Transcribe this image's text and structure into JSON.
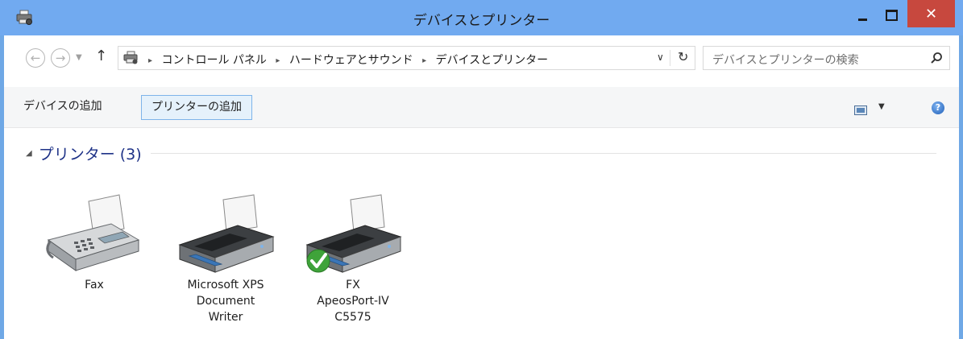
{
  "window": {
    "title": "デバイスとプリンター",
    "close_glyph": "✕"
  },
  "nav": {
    "back_glyph": "←",
    "forward_glyph": "→",
    "recent_glyph": "▼",
    "up_glyph": "↑",
    "breadcrumbs": [
      "コントロール パネル",
      "ハードウェアとサウンド",
      "デバイスとプリンター"
    ],
    "crumb_separator": "▸",
    "dropdown_glyph": "∨",
    "refresh_glyph": "↻",
    "search_placeholder": "デバイスとプリンターの検索"
  },
  "commands": {
    "add_device": "デバイスの追加",
    "add_printer": "プリンターの追加",
    "view_dropdown_glyph": "▼",
    "help_glyph": "?"
  },
  "group": {
    "collapse_glyph": "◢",
    "title": "プリンター (3)"
  },
  "devices": [
    {
      "label_lines": [
        "Fax"
      ],
      "icon": "fax-icon",
      "is_default": false
    },
    {
      "label_lines": [
        "Microsoft XPS",
        "Document",
        "Writer"
      ],
      "icon": "printer-icon",
      "is_default": false
    },
    {
      "label_lines": [
        "FX",
        "ApeosPort-IV",
        "C5575"
      ],
      "icon": "printer-icon",
      "is_default": true
    }
  ],
  "colors": {
    "titlebar": "#71aaf0",
    "close_button": "#c7483e",
    "group_title": "#1e3287",
    "selected_command_bg": "#e5f1fb",
    "default_check": "#3fa33a"
  }
}
